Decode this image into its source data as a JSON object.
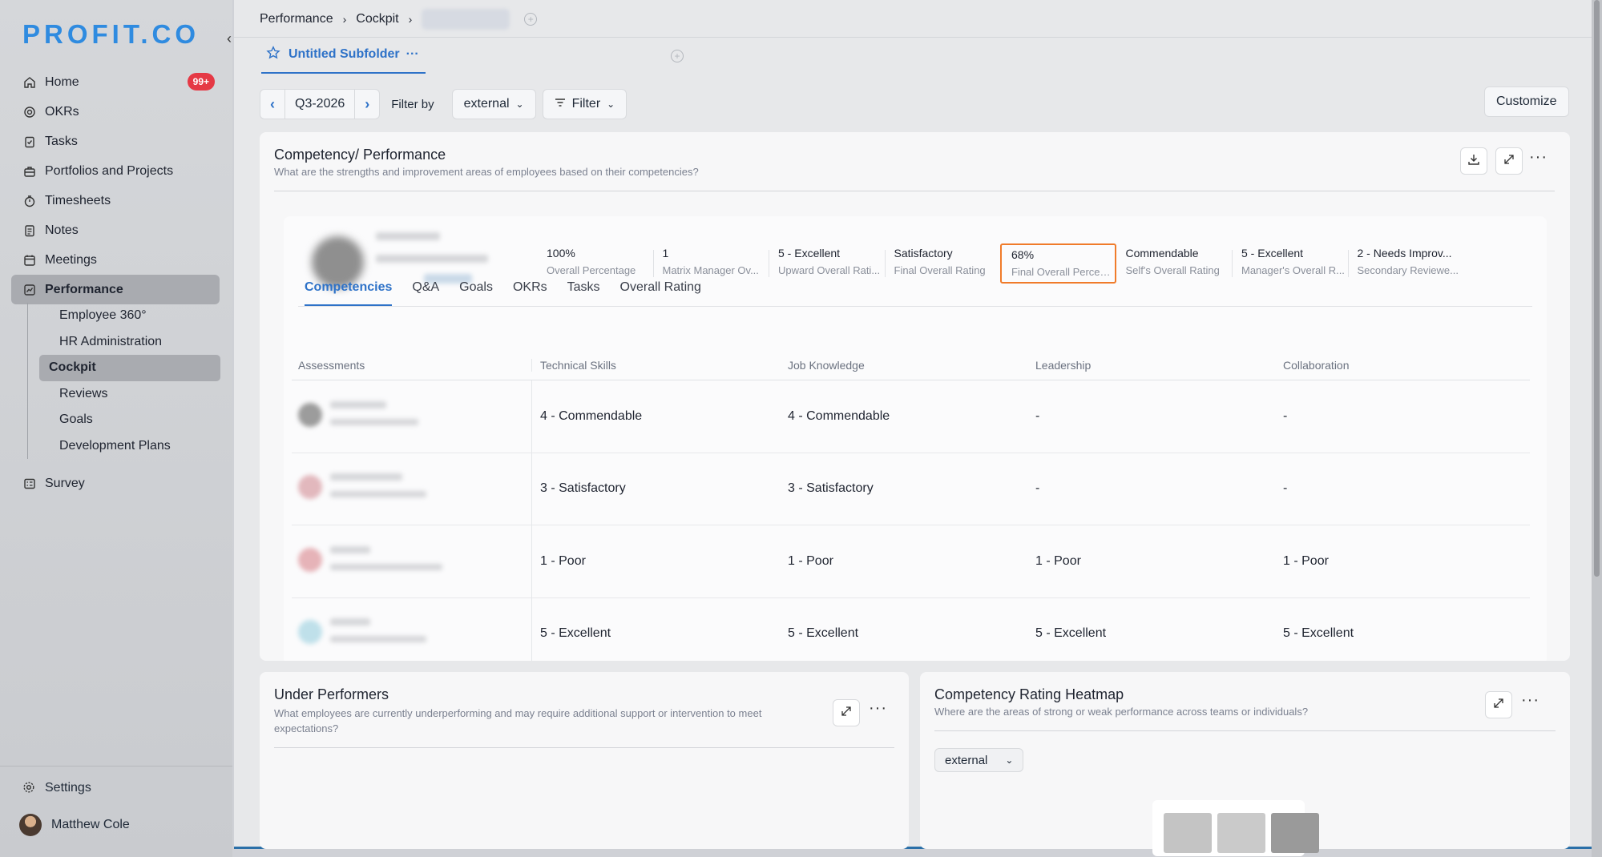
{
  "brand": {
    "logo": "PROFIT.CO"
  },
  "sidebar": {
    "items": [
      {
        "label": "Home",
        "icon": "home-icon",
        "badge": "99+"
      },
      {
        "label": "OKRs",
        "icon": "target-icon"
      },
      {
        "label": "Tasks",
        "icon": "clipboard-check-icon"
      },
      {
        "label": "Portfolios and Projects",
        "icon": "briefcase-icon"
      },
      {
        "label": "Timesheets",
        "icon": "stopwatch-icon"
      },
      {
        "label": "Notes",
        "icon": "notes-icon"
      },
      {
        "label": "Meetings",
        "icon": "calendar-icon"
      },
      {
        "label": "Performance",
        "icon": "chart-line-icon"
      }
    ],
    "performance_sub": [
      "Employee 360°",
      "HR Administration",
      "Cockpit",
      "Reviews",
      "Goals",
      "Development Plans"
    ],
    "survey": "Survey",
    "settings": "Settings",
    "user": "Matthew Cole"
  },
  "breadcrumb": {
    "items": [
      "Performance",
      "Cockpit"
    ]
  },
  "subfolder_tab": "Untitled Subfolder",
  "toolbar": {
    "period": "Q3-2026",
    "filter_by": "Filter by",
    "filter_value": "external",
    "filter_button": "Filter",
    "customize": "Customize"
  },
  "competency_card": {
    "title": "Competency/ Performance",
    "subtitle": "What are the strengths and improvement areas of employees based on their competencies?",
    "metrics": [
      {
        "value": "100%",
        "label": "Overall Percentage"
      },
      {
        "value": "1",
        "label": "Matrix Manager Ov..."
      },
      {
        "value": "5 - Excellent",
        "label": "Upward Overall Rati..."
      },
      {
        "value": "Satisfactory",
        "label": "Final Overall Rating"
      },
      {
        "value": "68%",
        "label": "Final Overall Percen..."
      },
      {
        "value": "Commendable",
        "label": "Self's Overall Rating"
      },
      {
        "value": "5 - Excellent",
        "label": "Manager's Overall R..."
      },
      {
        "value": "2 - Needs Improv...",
        "label": "Secondary Reviewe..."
      }
    ],
    "tabs": [
      "Competencies",
      "Q&A",
      "Goals",
      "OKRs",
      "Tasks",
      "Overall Rating"
    ],
    "table": {
      "headers": [
        "Assessments",
        "Technical Skills",
        "Job Knowledge",
        "Leadership",
        "Collaboration"
      ],
      "rows": [
        [
          "4 - Commendable",
          "4 - Commendable",
          "-",
          "-"
        ],
        [
          "3 - Satisfactory",
          "3 - Satisfactory",
          "-",
          "-"
        ],
        [
          "1 - Poor",
          "1 - Poor",
          "1 - Poor",
          "1 - Poor"
        ],
        [
          "5 - Excellent",
          "5 - Excellent",
          "5 - Excellent",
          "5 - Excellent"
        ]
      ]
    }
  },
  "under_performers": {
    "title": "Under Performers",
    "subtitle": "What employees are currently underperforming and may require additional support or intervention to meet expectations?"
  },
  "heatmap": {
    "title": "Competency Rating Heatmap",
    "subtitle": "Where are the areas of strong or weak performance across teams or individuals?",
    "filter": "external"
  },
  "colors": {
    "accent": "#2e72c8",
    "highlight": "#f07b2a",
    "badge": "#e53945",
    "logo": "#2f8be0"
  }
}
